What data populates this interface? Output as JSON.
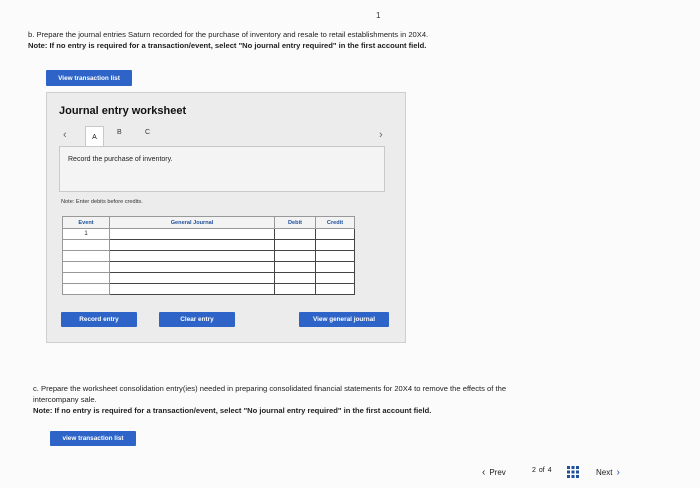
{
  "page": {
    "stray_mark": "1"
  },
  "question_b": {
    "text": "b. Prepare the journal entries Saturn recorded for the purchase of inventory and resale to retail establishments in 20X4.",
    "note": "Note: If no entry is required for a transaction/event, select \"No journal entry required\" in the first account field."
  },
  "view_transaction_list_1": "View transaction list",
  "worksheet": {
    "title": "Journal entry worksheet",
    "tabs": [
      "A",
      "B",
      "C"
    ],
    "active_tab_index": 0,
    "description": "Record the purchase of inventory.",
    "note": "Note: Enter debits before credits.",
    "columns": [
      "Event",
      "General Journal",
      "Debit",
      "Credit"
    ],
    "rows": [
      {
        "event": "1",
        "account": "",
        "debit": "",
        "credit": ""
      },
      {
        "event": "",
        "account": "",
        "debit": "",
        "credit": ""
      },
      {
        "event": "",
        "account": "",
        "debit": "",
        "credit": ""
      },
      {
        "event": "",
        "account": "",
        "debit": "",
        "credit": ""
      },
      {
        "event": "",
        "account": "",
        "debit": "",
        "credit": ""
      },
      {
        "event": "",
        "account": "",
        "debit": "",
        "credit": ""
      }
    ],
    "buttons": {
      "record": "Record entry",
      "clear": "Clear entry",
      "view_journal": "View general journal"
    }
  },
  "question_c": {
    "text": "c. Prepare the worksheet consolidation entry(ies) needed in preparing consolidated financial statements for 20X4 to remove the effects of the intercompany sale.",
    "note": "Note: If no entry is required for a transaction/event, select \"No journal entry required\" in the first account field."
  },
  "view_transaction_list_2": "view transaction list",
  "footer": {
    "prev_label": "Prev",
    "page_current": "2",
    "page_of": "of",
    "page_total": "4",
    "next_label": "Next"
  },
  "colors": {
    "button_blue": "#2e64c7",
    "header_text_blue": "#1d4f9a"
  }
}
